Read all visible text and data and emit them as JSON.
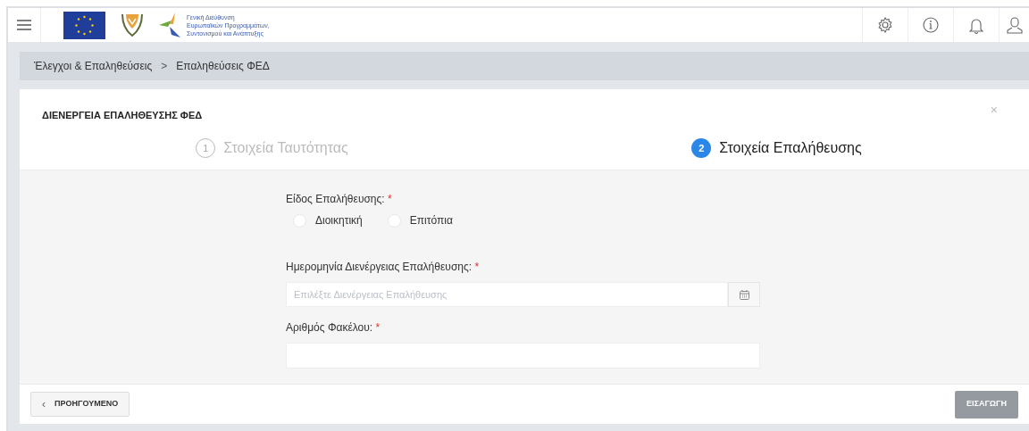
{
  "header": {
    "logo_text": [
      "Γενική Διεύθυνση",
      "Ευρωπαϊκών Προγραμμάτων,",
      "Συντονισμού και Ανάπτυξης"
    ]
  },
  "breadcrumb": [
    {
      "label": "Έλεγχοι & Επαληθεύσεις"
    },
    {
      "label": "Επαληθεύσεις ΦΕΔ"
    }
  ],
  "breadcrumb_separator": ">",
  "dialog": {
    "title": "ΔΙΕΝΕΡΓΕΙΑ ΕΠΑΛΗΘΕΥΣΗΣ ΦΕΔ",
    "close": "×",
    "steps": [
      {
        "number": "1",
        "label": "Στοιχεία Ταυτότητας",
        "selected": false
      },
      {
        "number": "2",
        "label": "Στοιχεία Επαλήθευσης",
        "selected": true
      }
    ],
    "verification_type": {
      "label": "Είδος Επαλήθευσης:",
      "required": "*",
      "options": [
        {
          "label": "Διοικητική",
          "selected": false
        },
        {
          "label": "Επιτόπια",
          "selected": false
        }
      ]
    },
    "date_field": {
      "label": "Ημερομηνία Διενέργειας Επαλήθευσης:",
      "required": "*",
      "placeholder": "Επιλέξτε Διενέργειας Επαλήθευσης"
    },
    "folder_field": {
      "label": "Αριθμός Φακέλου:",
      "required": "*"
    },
    "previous_button": {
      "icon": "‹",
      "label": "ΠΡΟΗΓΟΥΜΕΝΟ"
    },
    "submit_button": {
      "label": "ΕΙΣΑΓΩΓΗ",
      "disabled": true
    }
  }
}
